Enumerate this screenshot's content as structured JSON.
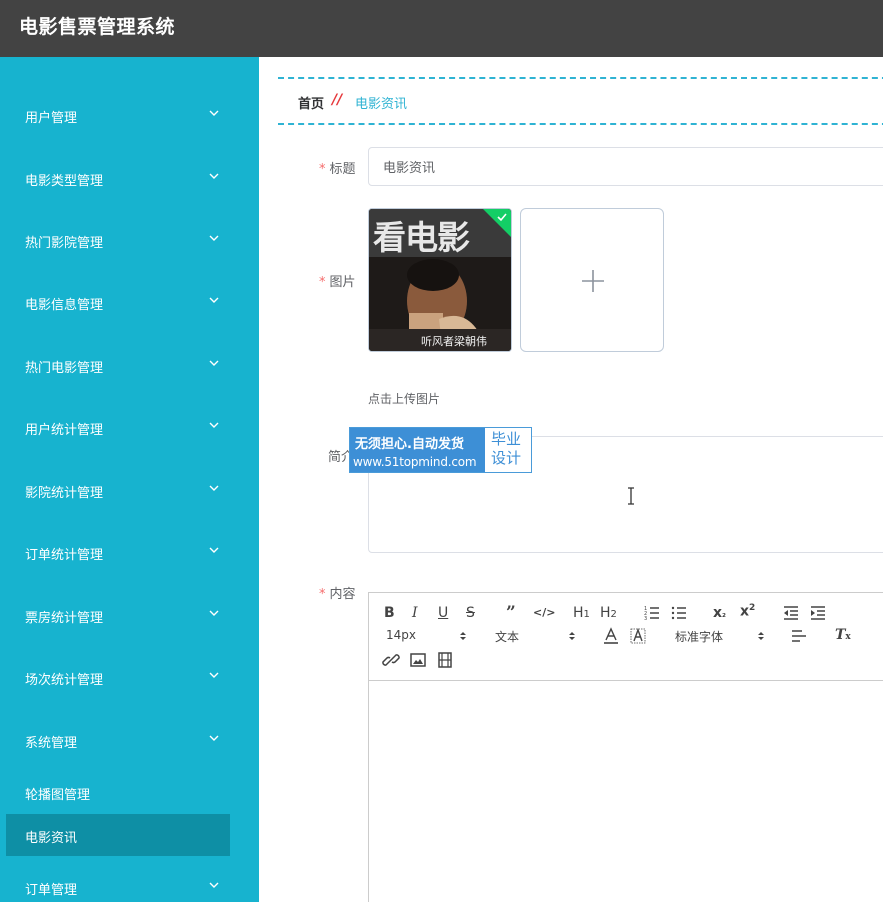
{
  "app": {
    "title": "电影售票管理系统"
  },
  "sidebar": {
    "items": [
      {
        "label": "用户管理"
      },
      {
        "label": "电影类型管理"
      },
      {
        "label": "热门影院管理"
      },
      {
        "label": "电影信息管理"
      },
      {
        "label": "热门电影管理"
      },
      {
        "label": "用户统计管理"
      },
      {
        "label": "影院统计管理"
      },
      {
        "label": "订单统计管理"
      },
      {
        "label": "票房统计管理"
      },
      {
        "label": "场次统计管理"
      },
      {
        "label": "系统管理"
      }
    ],
    "sub_items": [
      {
        "label": "轮播图管理"
      },
      {
        "label": "电影资讯",
        "active": true
      }
    ],
    "last_item": {
      "label": "订单管理"
    },
    "colors": {
      "bg": "#17b3cf",
      "active": "#0e8fa5"
    }
  },
  "breadcrumb": {
    "home": "首页",
    "separator": "//",
    "current": "电影资讯"
  },
  "form": {
    "title_label": "标题",
    "title_value": "电影资讯",
    "image_label": "图片",
    "image_thumb_text": "看电影",
    "image_caption": "听风者梁朝伟",
    "upload_tip": "点击上传图片",
    "intro_label": "简介",
    "content_label": "内容"
  },
  "editor": {
    "font_size": "14px",
    "block_type": "文本",
    "font_family": "标准字体"
  },
  "watermark": {
    "line1": "无须担心.自动发货",
    "line2": "www.51topmind.com",
    "right_line1": "毕业",
    "right_line2": "设计"
  },
  "colors": {
    "topbar": "#434343",
    "accent": "#2fb3d3",
    "required": "#f56c6c",
    "success": "#13ce66"
  }
}
